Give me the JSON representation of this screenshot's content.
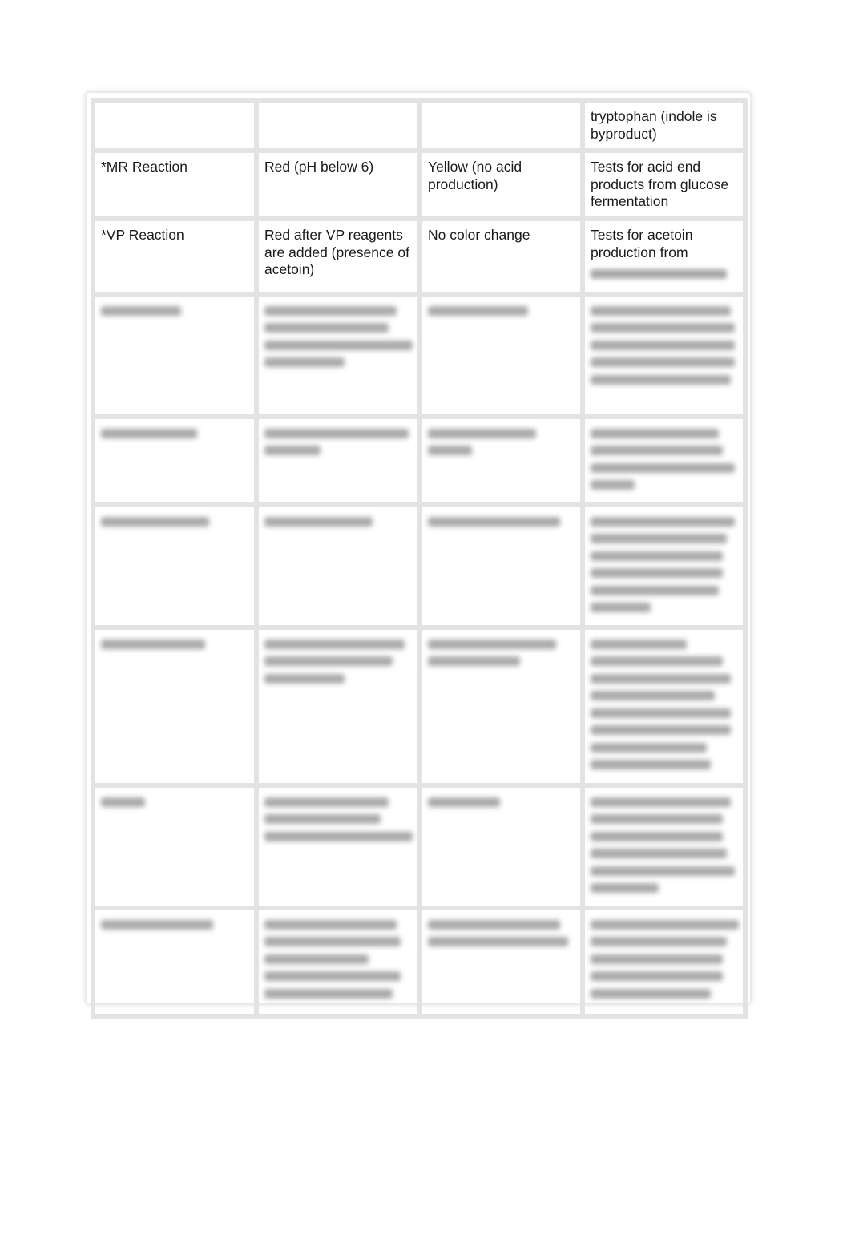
{
  "document": {
    "table": {
      "rows": [
        {
          "cells": [
            "",
            "",
            "",
            "tryptophan (indole is byproduct)"
          ],
          "blurred": false
        },
        {
          "cells": [
            "*MR Reaction",
            "Red (pH below 6)",
            "Yellow (no acid production)",
            "Tests for acid end products from glucose fermentation"
          ],
          "blurred": false
        },
        {
          "cells": [
            "*VP Reaction",
            "Red after VP reagents are added (presence of acetoin)",
            "No color change",
            "Tests for acetoin production from"
          ],
          "blurred": false
        },
        {
          "cells": [
            "[blurred]",
            "[blurred]",
            "[blurred]",
            "[blurred]"
          ],
          "blurred": true
        },
        {
          "cells": [
            "[blurred]",
            "[blurred]",
            "[blurred]",
            "[blurred]"
          ],
          "blurred": true
        },
        {
          "cells": [
            "[blurred]",
            "[blurred]",
            "[blurred]",
            "[blurred]"
          ],
          "blurred": true
        },
        {
          "cells": [
            "[blurred]",
            "[blurred]",
            "[blurred]",
            "[blurred]"
          ],
          "blurred": true
        },
        {
          "cells": [
            "[blurred]",
            "[blurred]",
            "[blurred]",
            "[blurred]"
          ],
          "blurred": true
        },
        {
          "cells": [
            "[blurred]",
            "[blurred]",
            "[blurred]",
            "[blurred]"
          ],
          "blurred": true
        }
      ]
    }
  }
}
